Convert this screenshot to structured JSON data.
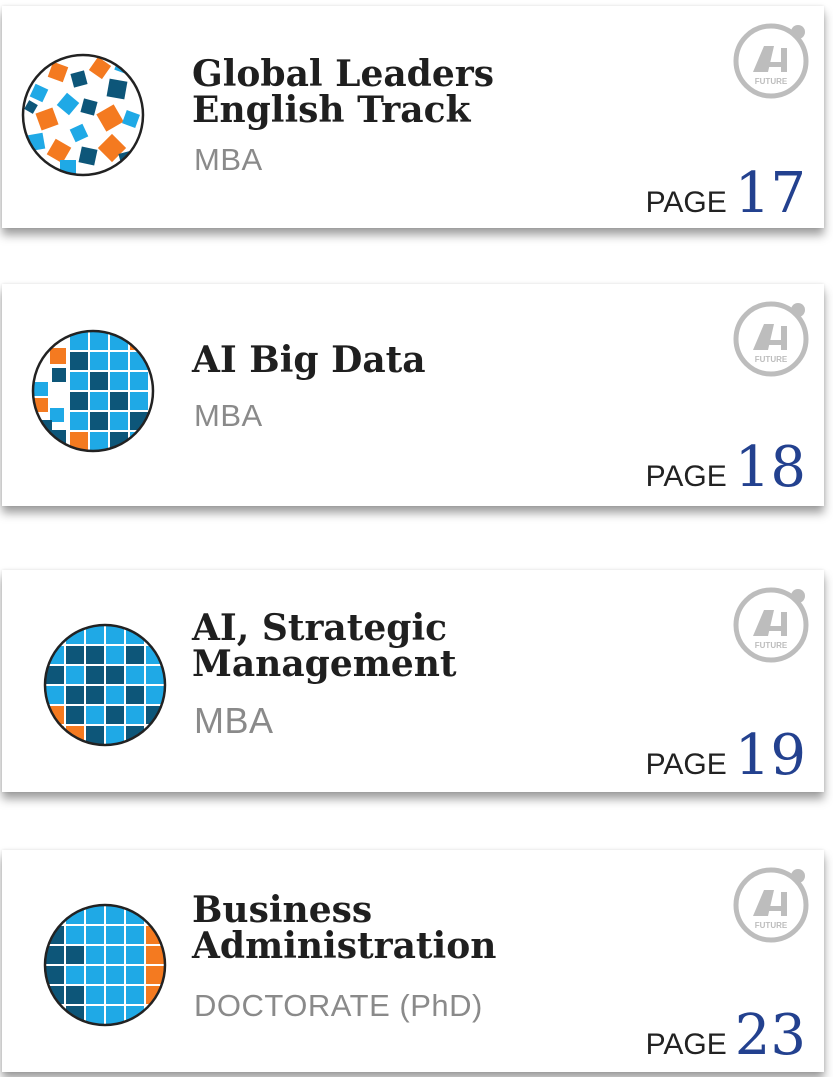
{
  "logo": {
    "brand": "AI",
    "tagline": "FUTURE"
  },
  "page_label": "PAGE",
  "cards": [
    {
      "title_lines": [
        "Global Leaders",
        "English Track"
      ],
      "degree": "MBA",
      "page": "17",
      "emblem": "scattered-squares"
    },
    {
      "title_lines": [
        "AI Big Data"
      ],
      "degree": "MBA",
      "page": "18",
      "emblem": "grid-blue-left-scatter"
    },
    {
      "title_lines": [
        "AI, Strategic",
        "Management"
      ],
      "degree": "MBA",
      "page": "19",
      "emblem": "grid-mixed"
    },
    {
      "title_lines": [
        "Business",
        "Administration"
      ],
      "degree": "DOCTORATE (PhD)",
      "page": "23",
      "emblem": "grid-full-blue"
    }
  ],
  "colors": {
    "orange": "#f47a20",
    "light_blue": "#1fa9e6",
    "dark_blue": "#0d5679",
    "page_number": "#23418f",
    "logo_gray": "#bdbdbd"
  }
}
